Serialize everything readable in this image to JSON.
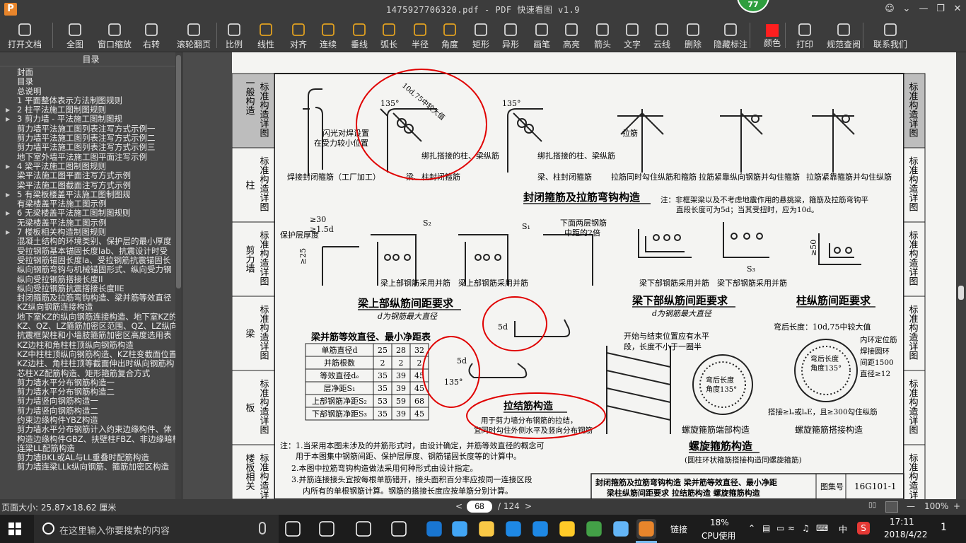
{
  "app": {
    "logo": "P",
    "title": "1475927706320.pdf - PDF 快速看图 v1.9",
    "badge": "77"
  },
  "toolbar": {
    "items": [
      {
        "id": "open",
        "label": "打开文档",
        "icon": "folder-icon"
      },
      {
        "id": "fit",
        "label": "全图",
        "icon": "fit-icon"
      },
      {
        "id": "zoom",
        "label": "窗口缩放",
        "icon": "magnifier-icon"
      },
      {
        "id": "rotate",
        "label": "右转",
        "icon": "rotate-icon"
      },
      {
        "id": "wheel",
        "label": "滚轮翻页",
        "icon": "mouse-icon"
      },
      {
        "id": "scale",
        "label": "比例",
        "icon": "ruler-icon"
      },
      {
        "id": "linear",
        "label": "线性",
        "icon": "linear-icon"
      },
      {
        "id": "align",
        "label": "对齐",
        "icon": "align-icon"
      },
      {
        "id": "continuous",
        "label": "连续",
        "icon": "continuous-icon"
      },
      {
        "id": "perp",
        "label": "垂线",
        "icon": "perpendicular-icon"
      },
      {
        "id": "arc",
        "label": "弧长",
        "icon": "arc-icon"
      },
      {
        "id": "radius",
        "label": "半径",
        "icon": "radius-icon"
      },
      {
        "id": "angle",
        "label": "角度",
        "icon": "angle-icon"
      },
      {
        "id": "rect",
        "label": "矩形",
        "icon": "rectangle-icon"
      },
      {
        "id": "shape",
        "label": "异形",
        "icon": "polygon-icon"
      },
      {
        "id": "pen",
        "label": "画笔",
        "icon": "pen-icon"
      },
      {
        "id": "highlight",
        "label": "高亮",
        "icon": "highlighter-icon"
      },
      {
        "id": "arrow",
        "label": "箭头",
        "icon": "arrow-icon"
      },
      {
        "id": "text",
        "label": "文字",
        "icon": "text-icon"
      },
      {
        "id": "cloud",
        "label": "云线",
        "icon": "cloud-icon"
      },
      {
        "id": "erase",
        "label": "删除",
        "icon": "eraser-icon"
      },
      {
        "id": "hide",
        "label": "隐藏标注",
        "icon": "eye-slash-icon"
      },
      {
        "id": "color",
        "label": "颜色",
        "icon": "color-swatch-icon"
      },
      {
        "id": "print",
        "label": "打印",
        "icon": "printer-icon"
      },
      {
        "id": "spec",
        "label": "规范查阅",
        "icon": "book-icon"
      },
      {
        "id": "contact",
        "label": "联系我们",
        "icon": "support-icon"
      }
    ]
  },
  "sidebar": {
    "header": "目录",
    "items": [
      {
        "t": "封面",
        "c": false
      },
      {
        "t": "目录",
        "c": false
      },
      {
        "t": "总说明",
        "c": false
      },
      {
        "t": "1  平面整体表示方法制图规则",
        "c": false
      },
      {
        "t": "2  柱平法施工图制图规则",
        "c": true
      },
      {
        "t": "3  剪力墙 - 平法施工图制图规",
        "c": true
      },
      {
        "t": "剪力墙平法施工图列表注写方式示例一",
        "c": false
      },
      {
        "t": "剪力墙平法施工图列表注写方式示例二",
        "c": false
      },
      {
        "t": "剪力墙平法施工图列表注写方式示例三",
        "c": false
      },
      {
        "t": "地下室外墙平法施工图平面注写示例",
        "c": false
      },
      {
        "t": "4  梁平法施工图制图规则",
        "c": true
      },
      {
        "t": "梁平法施工图平面注写方式示例",
        "c": false
      },
      {
        "t": "梁平法施工图截面注写方式示例",
        "c": false
      },
      {
        "t": "5  有梁板楼盖平法施工图制图规",
        "c": true
      },
      {
        "t": "有梁楼盖平法施工图示例",
        "c": false
      },
      {
        "t": "6  无梁楼盖平法施工图制图规则",
        "c": true
      },
      {
        "t": "无梁楼盖平法施工图示例",
        "c": false
      },
      {
        "t": "7  楼板相关构造制图规则",
        "c": true
      },
      {
        "t": "混凝土结构的环境类别、保护层的最小厚度",
        "c": false
      },
      {
        "t": "受拉钢筋基本锚固长度lab、抗震设计时受",
        "c": false
      },
      {
        "t": "受拉钢筋锚固长度la、受拉钢筋抗震锚固长",
        "c": false
      },
      {
        "t": "纵向钢筋弯钩与机械锚固形式、纵向受力钢",
        "c": false
      },
      {
        "t": "纵向受拉钢筋搭接长度ll",
        "c": false
      },
      {
        "t": "纵向受拉钢筋抗震搭接长度llE",
        "c": false
      },
      {
        "t": "封闭箍筋及拉筋弯钩构造、梁并筋等效直径",
        "c": false
      },
      {
        "t": "KZ纵向钢筋连接构造",
        "c": false
      },
      {
        "t": "地下室KZ的纵向钢筋连接构造、地下室KZ的",
        "c": false
      },
      {
        "t": "KZ、QZ、LZ箍筋加密区范围、QZ、LZ纵向钢",
        "c": false
      },
      {
        "t": "抗震框架柱和小墙肢箍筋加密区高度选用表",
        "c": false
      },
      {
        "t": "KZ边柱和角柱柱顶纵向钢筋构造",
        "c": false
      },
      {
        "t": "KZ中柱柱顶纵向钢筋构造、KZ柱变截面位置",
        "c": false
      },
      {
        "t": "KZ边柱、角柱柱顶等截面伸出时纵向钢筋构",
        "c": false
      },
      {
        "t": "芯柱XZ配筋构造、矩形箍筋复合方式",
        "c": false
      },
      {
        "t": "剪力墙水平分布钢筋构造一",
        "c": false
      },
      {
        "t": "剪力墙水平分布钢筋构造二",
        "c": false
      },
      {
        "t": "剪力墙竖向钢筋构造一",
        "c": false
      },
      {
        "t": "剪力墙竖向钢筋构造二",
        "c": false
      },
      {
        "t": "约束边缘构件YBZ构造",
        "c": false
      },
      {
        "t": "剪力墙水平分布钢筋计入约束边缘构件、体",
        "c": false
      },
      {
        "t": "构造边缘构件GBZ、扶壁柱FBZ、非边缘暗柱",
        "c": false
      },
      {
        "t": "连梁LL配筋构造",
        "c": false
      },
      {
        "t": "剪力墙BKL或AL与LL重叠时配筋构造",
        "c": false
      },
      {
        "t": "剪力墙连梁LLk纵向钢筋、箍筋加密区构造",
        "c": false
      }
    ]
  },
  "document": {
    "side_tabs": [
      "一般构造",
      "柱",
      "剪力墙",
      "梁",
      "板",
      "楼板相关"
    ],
    "side_tab_label": "标准构造详图",
    "right_tab_label": "标准构造详图",
    "titles": {
      "closed_stirrup": "封闭箍筋及拉筋弯钩构造",
      "beam_top": "梁上部纵筋间距要求",
      "beam_bottom": "梁下部纵筋间距要求",
      "column_spacing": "柱纵筋间距要求",
      "tie_bar": "拉结筋构造",
      "spiral": "螺旋箍筋构造",
      "equiv_table": "梁并筋等效直径、最小净距表",
      "spiral_end": "螺旋箍筋端部构造",
      "spiral_lap": "螺旋箍筋搭接构造"
    },
    "notes": {
      "d_max": "d为钢筋最大直径",
      "d_max2": "d为钢筋最大直径",
      "non_frame": "注：非框架梁以及不考虑地震作用的悬挑梁，箍筋及拉筋弯钩平",
      "non_frame2": "直段长度可为5d；当其受扭时，应为10d。",
      "tie_desc": "用于剪力墙分布钢筋的拉结，",
      "tie_desc2": "宜同时勾住外侧水平及竖向分布钢筋",
      "spiral_sub": "(圆柱环状箍筋搭接构造同螺旋箍筋)",
      "start_end": "开始与结束位置应有水平",
      "start_end2": "段，长度不小于一圈半",
      "bend_len": "弯后长度：10d,75中较大值",
      "inner_ring": "内环定位筋",
      "weld_ring": "焊接圆环",
      "ring_spacing": "间距1500",
      "ring_dia": "直径≥12",
      "lap": "搭接≥lₐ或lₐE，且≥300勾住纵筋",
      "bend_after": "弯后长度",
      "angle135": "角度135°",
      "flash": "闪光对焊设置",
      "flash2": "在受力较小位置",
      "weld_hoop": "焊接封闭箍筋（工厂加工）",
      "beam_hoop": "梁、柱封闭箍筋",
      "beam_hoop2": "梁、柱封闭箍筋",
      "tie_lap": "绑扎搭接的柱、梁纵筋",
      "tie_lap2": "绑扎搭接的柱、梁纵筋",
      "tie_hold": "拉筋同时勾住纵筋和箍筋",
      "tie_tight_long": "拉筋紧靠纵向钢筋并勾住箍筋",
      "tie_tight_hoop": "拉筋紧靠箍筋并勾住纵筋",
      "top_bundle": "梁上部钢筋采用并筋",
      "bottom_bundle": "梁下部钢筋采用并筋",
      "cover": "保护层厚度",
      "two_layer": "下面两层钢筋",
      "two_layer2": "中距的2倍",
      "hook": "10d,75中较大值",
      "tie": "拉筋",
      "ge30": "≥30",
      "ge15d": "≥1.5d",
      "ge25": "≥25",
      "ge50": "≥50",
      "note1": "注：1.当采用本图未涉及的并筋形式时，由设计确定，并筋等效直径的概念可",
      "note1b": "用于本图集中钢筋间距、保护层厚度、钢筋锚固长度等的计算中。",
      "note2": "2.本图中拉筋弯钩构造做法采用何种形式由设计指定。",
      "note3": "3.并筋连接接头宜按每根单筋错开，接头面积百分率应按同一连接区段",
      "note3b": "内所有的单根钢筋计算。钢筋的搭接长度应按单筋分别计算。",
      "footer_title1": "封闭箍筋及拉筋弯钩构造  梁并筋等效直径、最小净距",
      "footer_title2": "梁柱纵筋间距要求  拉结筋构造  螺旋箍筋构造",
      "atlas_label": "图集号",
      "atlas_no": "16G101-1"
    },
    "table": {
      "rows": [
        {
          "label": "单筋直径d",
          "v": [
            "25",
            "28",
            "32"
          ]
        },
        {
          "label": "并筋根数",
          "v": [
            "2",
            "2",
            "2"
          ]
        },
        {
          "label": "等效直径dₑ",
          "v": [
            "35",
            "39",
            "45"
          ]
        },
        {
          "label": "层净距S₁",
          "v": [
            "35",
            "39",
            "45"
          ]
        },
        {
          "label": "上部钢筋净距S₂",
          "v": [
            "53",
            "59",
            "68"
          ]
        },
        {
          "label": "下部钢筋净距S₃",
          "v": [
            "35",
            "39",
            "45"
          ]
        }
      ]
    },
    "dims": {
      "a135": "135°",
      "d": "d",
      "s1": "S₁",
      "s2": "S₂",
      "s3": "S₃",
      "c": "c",
      "d5": "5d",
      "ge25b": "≥25",
      "ge50b": "≥50"
    }
  },
  "status": {
    "page_size": "页面大小: 25.87×18.62 厘米",
    "page": "68",
    "total": "/ 124",
    "zoom": "100%",
    "prev": "<",
    "next": ">",
    "zoom_minus": "—",
    "zoom_plus": "+"
  },
  "taskbar": {
    "search_placeholder": "在这里输入你要搜索的内容",
    "link_label": "链接",
    "cpu": "18%",
    "cpu_label": "CPU使用",
    "ime": "中",
    "time": "17:11",
    "date": "2018/4/22",
    "notif": "1"
  },
  "colors": {
    "toolbar_bg": "#3c3c3c",
    "annotation_red": "#e00000",
    "accent_blue": "#76b9ed"
  }
}
